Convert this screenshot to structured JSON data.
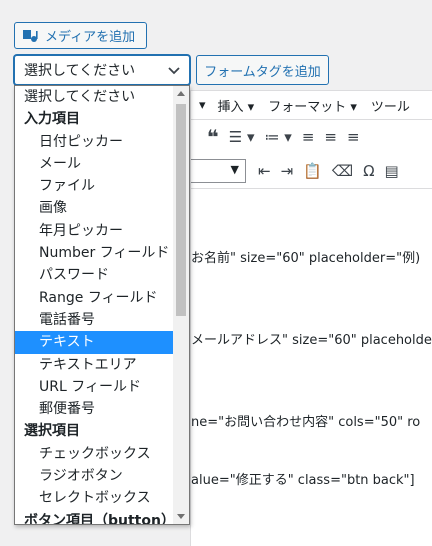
{
  "media_button": {
    "label": "メディアを追加"
  },
  "select": {
    "value": "選択してください"
  },
  "form_tag_button": {
    "label": "フォームタグを追加"
  },
  "editor": {
    "menubar": [
      "挿入 ▾",
      "フォーマット ▾",
      "ツール"
    ],
    "menubar_partial": "▾",
    "code_lines": [
      "お名前\" size=\"60\" placeholder=\"例)",
      "メールアドレス\" size=\"60\" placeholde",
      "ne=\"お問い合わせ内容\" cols=\"50\" ro",
      "alue=\"修正する\" class=\"btn back\"]"
    ]
  },
  "dropdown": {
    "options": [
      {
        "label": "選択してください",
        "kind": "plain"
      },
      {
        "label": "入力項目",
        "kind": "group"
      },
      {
        "label": "日付ピッカー",
        "kind": "child"
      },
      {
        "label": "メール",
        "kind": "child"
      },
      {
        "label": "ファイル",
        "kind": "child"
      },
      {
        "label": "画像",
        "kind": "child"
      },
      {
        "label": "年月ピッカー",
        "kind": "child"
      },
      {
        "label": "Number フィールド",
        "kind": "child"
      },
      {
        "label": "パスワード",
        "kind": "child"
      },
      {
        "label": "Range フィールド",
        "kind": "child"
      },
      {
        "label": "電話番号",
        "kind": "child"
      },
      {
        "label": "テキスト",
        "kind": "child",
        "selected": true
      },
      {
        "label": "テキストエリア",
        "kind": "child"
      },
      {
        "label": "URL フィールド",
        "kind": "child"
      },
      {
        "label": "郵便番号",
        "kind": "child"
      },
      {
        "label": "選択項目",
        "kind": "group"
      },
      {
        "label": "チェックボックス",
        "kind": "child"
      },
      {
        "label": "ラジオボタン",
        "kind": "child"
      },
      {
        "label": "セレクトボックス",
        "kind": "child"
      },
      {
        "label": "ボタン項目（button）",
        "kind": "group"
      }
    ]
  },
  "colors": {
    "accent": "#2271b1",
    "highlight": "#1e90ff"
  }
}
